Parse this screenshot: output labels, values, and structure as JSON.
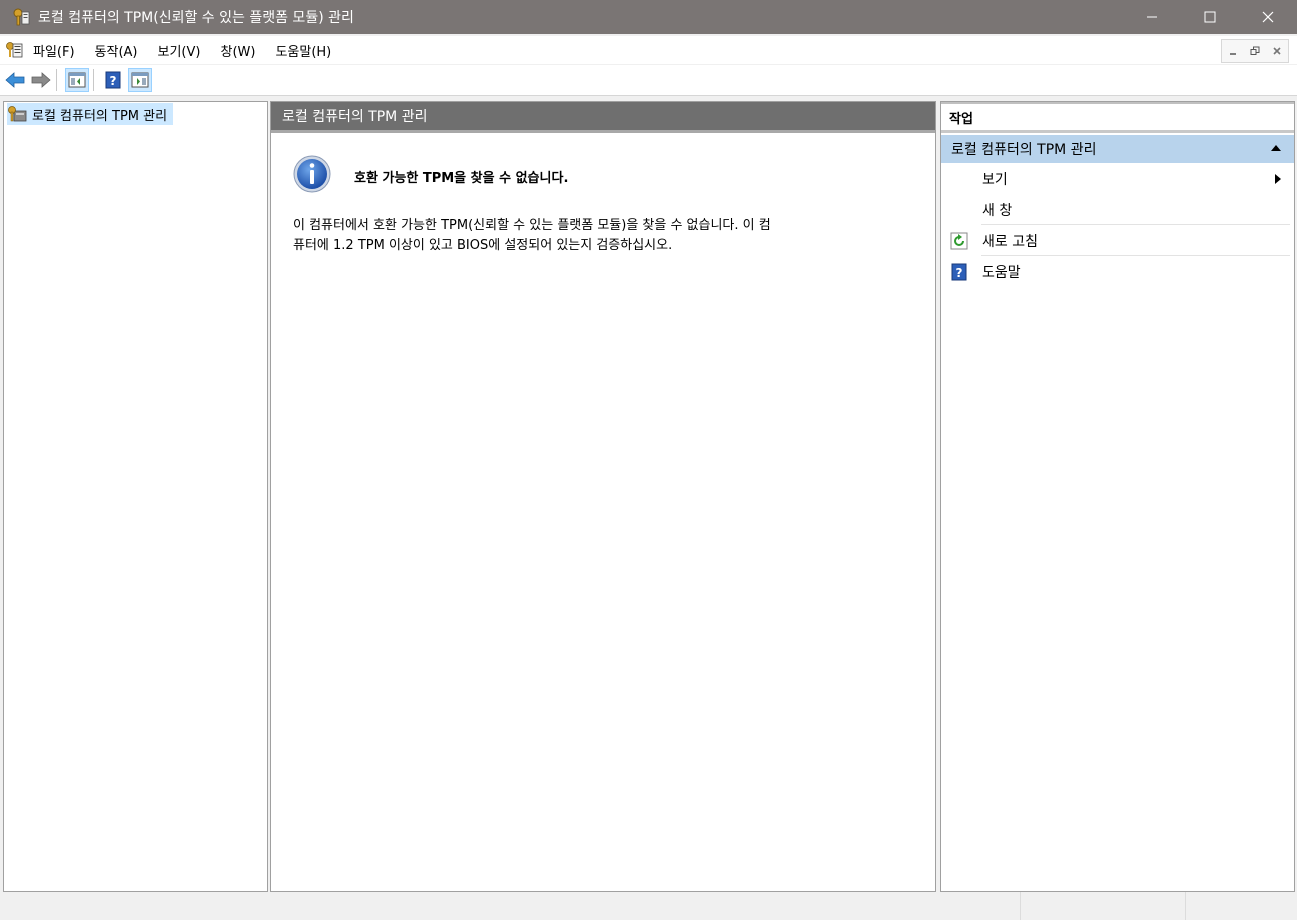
{
  "window": {
    "title": "로컬 컴퓨터의 TPM(신뢰할 수 있는 플랫폼 모듈) 관리",
    "controls": {
      "minimize": "—",
      "maximize": "☐",
      "close": "✕"
    }
  },
  "menubar": {
    "items": [
      "파일(F)",
      "동작(A)",
      "보기(V)",
      "창(W)",
      "도움말(H)"
    ]
  },
  "toolbar": {
    "buttons": [
      "back-arrow-icon",
      "forward-arrow-icon",
      "show-hide-console-tree-icon",
      "help-icon",
      "show-hide-action-pane-icon"
    ]
  },
  "tree": {
    "root_label": "로컬 컴퓨터의 TPM 관리"
  },
  "center": {
    "header": "로컬 컴퓨터의 TPM 관리",
    "message_title": "호환 가능한 TPM을 찾을 수 없습니다.",
    "message_line1": "이 컴퓨터에서 호환 가능한 TPM(신뢰할 수 있는 플랫폼 모듈)을 찾을 수 없습니다. 이 컴",
    "message_line2": "퓨터에 1.2 TPM 이상이 있고 BIOS에 설정되어 있는지 검증하십시오."
  },
  "actions": {
    "header": "작업",
    "group_label": "로컬 컴퓨터의 TPM 관리",
    "items": [
      "보기",
      "새 창",
      "새로 고침",
      "도움말"
    ]
  },
  "colors": {
    "titlebar": "#7a7574",
    "center_header": "#6f6f6f",
    "actions_group": "#b8d3ec",
    "selection": "#cce8ff"
  }
}
